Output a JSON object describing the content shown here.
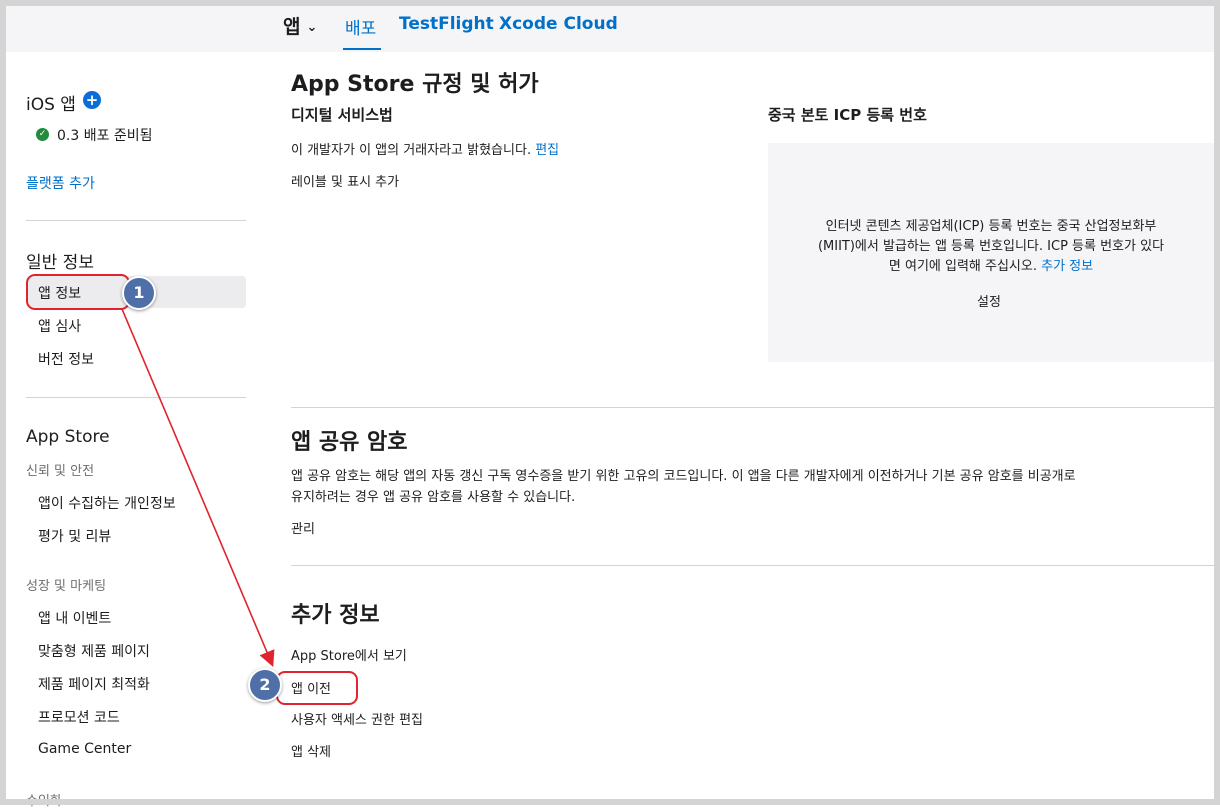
{
  "topnav": {
    "apps_label": "앱",
    "distribution_label": "배포",
    "testflight_label": "TestFlight",
    "xcode_cloud_label": "Xcode Cloud"
  },
  "sidebar": {
    "ios_app_label": "iOS 앱",
    "version_status": "0.3 배포 준비됨",
    "add_platform": "플랫폼 추가",
    "general_section": "일반 정보",
    "general_items": [
      "앱 정보",
      "앱 심사",
      "버전 정보"
    ],
    "app_store_section": "App Store",
    "trust_subsection": "신뢰 및 안전",
    "trust_items": [
      "앱이 수집하는 개인정보",
      "평가 및 리뷰"
    ],
    "growth_subsection": "성장 및 마케팅",
    "growth_items": [
      "앱 내 이벤트",
      "맞춤형 제품 페이지",
      "제품 페이지 최적화",
      "프로모션 코드",
      "Game Center"
    ],
    "cut_off_label": "수익화"
  },
  "main": {
    "regulation_title": "App Store 규정 및 허가",
    "dsa_heading": "디지털 서비스법",
    "dsa_text": "이 개발자가 이 앱의 거래자라고 밝혔습니다.",
    "dsa_edit": "편집",
    "dsa_add_label": "레이블 및 표시 추가",
    "icp_heading": "중국 본토 ICP 등록 번호",
    "icp_line1": "인터넷 콘텐츠 제공업체(ICP) 등록 번호는 중국 산업정보화부",
    "icp_line2": "(MIIT)에서 발급하는 앱 등록 번호입니다. ICP 등록 번호가 있다",
    "icp_line3": "면 여기에 입력해 주십시오.",
    "icp_more": "추가 정보",
    "icp_setup": "설정",
    "secret_title": "앱 공유 암호",
    "secret_line1": "앱 공유 암호는 해당 앱의 자동 갱신 구독 영수증을 받기 위한 고유의 코드입니다. 이 앱을 다른 개발자에게 이전하거나 기본 공유 암호를 비공개로",
    "secret_line2": "유지하려는 경우 앱 공유 암호를 사용할 수 있습니다.",
    "secret_manage": "관리",
    "additional_title": "추가 정보",
    "additional_links": [
      "App Store에서 보기",
      "앱 이전",
      "사용자 액세스 권한 편집",
      "앱 삭제"
    ]
  },
  "annotations": {
    "badge1": "1",
    "badge2": "2",
    "color": "#e0242e",
    "badge_color": "#4f6fa8"
  }
}
